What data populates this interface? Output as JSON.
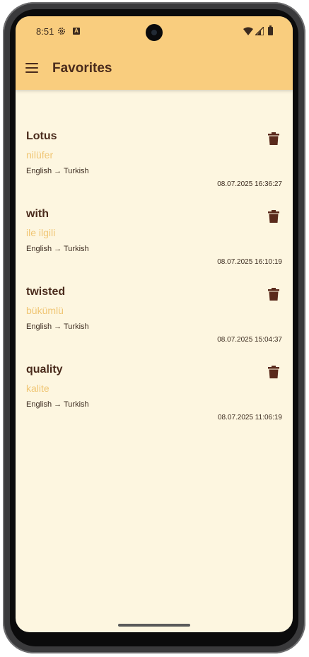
{
  "status_bar": {
    "time": "8:51",
    "a_icon_letter": "A"
  },
  "app_bar": {
    "title": "Favorites",
    "menu_icon": "hamburger-menu-icon"
  },
  "favorites": [
    {
      "word": "Lotus",
      "translation": "nilüfer",
      "languages": "English → Turkish",
      "date": "08.07.2025 16:36:27"
    },
    {
      "word": "with",
      "translation": "ile ilgili",
      "languages": "English → Turkish",
      "date": "08.07.2025 16:10:19"
    },
    {
      "word": "twisted",
      "translation": "bükümlü",
      "languages": "English → Turkish",
      "date": "08.07.2025 15:04:37"
    },
    {
      "word": "quality",
      "translation": "kalite",
      "languages": "English → Turkish",
      "date": "08.07.2025 11:06:19"
    }
  ],
  "colors": {
    "app_bar": "#f9cd7e",
    "background": "#fdf6e0",
    "title_text": "#4a2b1c",
    "translation_text": "#f0c675",
    "trash_icon": "#5a2a1c"
  }
}
